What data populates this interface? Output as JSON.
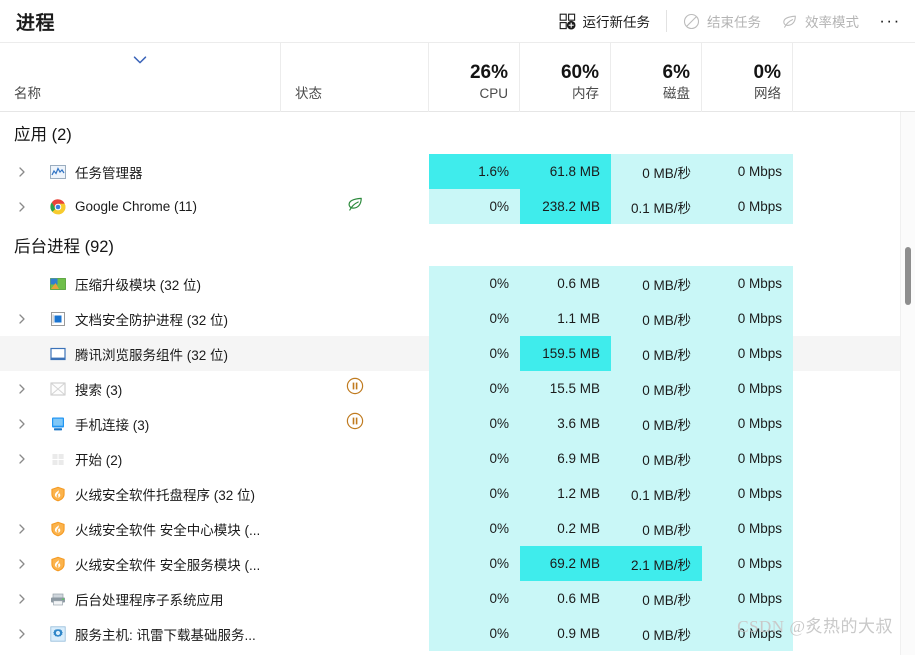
{
  "window": {
    "title": "进程"
  },
  "toolbar": {
    "run_new_task": {
      "label": "运行新任务",
      "icon": "new-task-icon",
      "enabled": true
    },
    "end_task": {
      "label": "结束任务",
      "icon": "end-task-icon",
      "enabled": false
    },
    "efficiency_mode": {
      "label": "效率模式",
      "icon": "leaf-icon",
      "enabled": false
    },
    "more": {
      "label": "···",
      "icon": "ellipsis-icon"
    }
  },
  "columns": [
    {
      "key": "name",
      "header": "名称",
      "pct": "",
      "sorted": true
    },
    {
      "key": "status",
      "header": "状态",
      "pct": ""
    },
    {
      "key": "cpu",
      "header": "CPU",
      "pct": "26%"
    },
    {
      "key": "memory",
      "header": "内存",
      "pct": "60%"
    },
    {
      "key": "disk",
      "header": "磁盘",
      "pct": "6%"
    },
    {
      "key": "network",
      "header": "网络",
      "pct": "0%"
    }
  ],
  "groups": [
    {
      "label": "应用 (2)",
      "count": 2
    },
    {
      "label": "后台进程 (92)",
      "count": 92
    }
  ],
  "rows": [
    {
      "type": "group",
      "name": "应用 (2)"
    },
    {
      "type": "proc",
      "name": "任务管理器",
      "expandable": true,
      "icon": "chart-icon",
      "status": "",
      "status_icon": "",
      "cpu": "1.6%",
      "memory": "61.8 MB",
      "disk": "0 MB/秒",
      "network": "0 Mbps",
      "heat": {
        "cpu": "h3",
        "memory": "h3",
        "disk": "h1",
        "network": "h1"
      }
    },
    {
      "type": "proc",
      "name": "Google Chrome (11)",
      "expandable": true,
      "icon": "chrome-icon",
      "status": "",
      "status_icon": "leaf-icon",
      "cpu": "0%",
      "memory": "238.2 MB",
      "disk": "0.1 MB/秒",
      "network": "0 Mbps",
      "heat": {
        "cpu": "h1",
        "memory": "h3",
        "disk": "h1",
        "network": "h1"
      }
    },
    {
      "type": "group",
      "name": "后台进程 (92)"
    },
    {
      "type": "proc",
      "name": "压缩升级模块 (32 位)",
      "expandable": false,
      "icon": "archive-icon",
      "status": "",
      "status_icon": "",
      "cpu": "0%",
      "memory": "0.6 MB",
      "disk": "0 MB/秒",
      "network": "0 Mbps",
      "heat": {
        "cpu": "h1",
        "memory": "h1",
        "disk": "h1",
        "network": "h1"
      }
    },
    {
      "type": "proc",
      "name": "文档安全防护进程 (32 位)",
      "expandable": true,
      "icon": "doc-secure-icon",
      "status": "",
      "status_icon": "",
      "cpu": "0%",
      "memory": "1.1 MB",
      "disk": "0 MB/秒",
      "network": "0 Mbps",
      "heat": {
        "cpu": "h1",
        "memory": "h1",
        "disk": "h1",
        "network": "h1"
      }
    },
    {
      "type": "proc",
      "name": "腾讯浏览服务组件 (32 位)",
      "expandable": false,
      "icon": "window-icon",
      "hover": true,
      "status": "",
      "status_icon": "",
      "cpu": "0%",
      "memory": "159.5 MB",
      "disk": "0 MB/秒",
      "network": "0 Mbps",
      "heat": {
        "cpu": "h1",
        "memory": "h3",
        "disk": "h1",
        "network": "h1"
      }
    },
    {
      "type": "proc",
      "name": "搜索 (3)",
      "expandable": true,
      "icon": "search-box-icon",
      "status": "",
      "status_icon": "pause-icon",
      "cpu": "0%",
      "memory": "15.5 MB",
      "disk": "0 MB/秒",
      "network": "0 Mbps",
      "heat": {
        "cpu": "h1",
        "memory": "h1",
        "disk": "h1",
        "network": "h1"
      }
    },
    {
      "type": "proc",
      "name": "手机连接 (3)",
      "expandable": true,
      "icon": "phone-link-icon",
      "status": "",
      "status_icon": "pause-icon",
      "cpu": "0%",
      "memory": "3.6 MB",
      "disk": "0 MB/秒",
      "network": "0 Mbps",
      "heat": {
        "cpu": "h1",
        "memory": "h1",
        "disk": "h1",
        "network": "h1"
      }
    },
    {
      "type": "proc",
      "name": "开始 (2)",
      "expandable": true,
      "icon": "start-icon",
      "status": "",
      "status_icon": "",
      "cpu": "0%",
      "memory": "6.9 MB",
      "disk": "0 MB/秒",
      "network": "0 Mbps",
      "heat": {
        "cpu": "h1",
        "memory": "h1",
        "disk": "h1",
        "network": "h1"
      }
    },
    {
      "type": "proc",
      "name": "火绒安全软件托盘程序 (32 位)",
      "expandable": false,
      "icon": "huorong-icon",
      "status": "",
      "status_icon": "",
      "cpu": "0%",
      "memory": "1.2 MB",
      "disk": "0.1 MB/秒",
      "network": "0 Mbps",
      "heat": {
        "cpu": "h1",
        "memory": "h1",
        "disk": "h1",
        "network": "h1"
      }
    },
    {
      "type": "proc",
      "name": "火绒安全软件 安全中心模块 (...",
      "expandable": true,
      "icon": "huorong-icon",
      "status": "",
      "status_icon": "",
      "cpu": "0%",
      "memory": "0.2 MB",
      "disk": "0 MB/秒",
      "network": "0 Mbps",
      "heat": {
        "cpu": "h1",
        "memory": "h1",
        "disk": "h1",
        "network": "h1"
      }
    },
    {
      "type": "proc",
      "name": "火绒安全软件 安全服务模块 (...",
      "expandable": true,
      "icon": "huorong-icon",
      "status": "",
      "status_icon": "",
      "cpu": "0%",
      "memory": "69.2 MB",
      "disk": "2.1 MB/秒",
      "network": "0 Mbps",
      "heat": {
        "cpu": "h1",
        "memory": "h3",
        "disk": "h3",
        "network": "h1"
      }
    },
    {
      "type": "proc",
      "name": "后台处理程序子系统应用",
      "expandable": true,
      "icon": "printer-icon",
      "status": "",
      "status_icon": "",
      "cpu": "0%",
      "memory": "0.6 MB",
      "disk": "0 MB/秒",
      "network": "0 Mbps",
      "heat": {
        "cpu": "h1",
        "memory": "h1",
        "disk": "h1",
        "network": "h1"
      }
    },
    {
      "type": "proc",
      "name": "服务主机: 讯雷下载基础服务...",
      "expandable": true,
      "icon": "gear-icon",
      "status": "",
      "status_icon": "",
      "cpu": "0%",
      "memory": "0.9 MB",
      "disk": "0 MB/秒",
      "network": "0 Mbps",
      "heat": {
        "cpu": "h1",
        "memory": "h1",
        "disk": "h1",
        "network": "h1"
      }
    }
  ],
  "watermark": "CSDN @炙热的大叔",
  "colors": {
    "heat_light": "#c9f7f7",
    "heat_strong": "#3fecec",
    "accent_pause": "#c07b20",
    "leaf_green": "#2c8a3c"
  }
}
